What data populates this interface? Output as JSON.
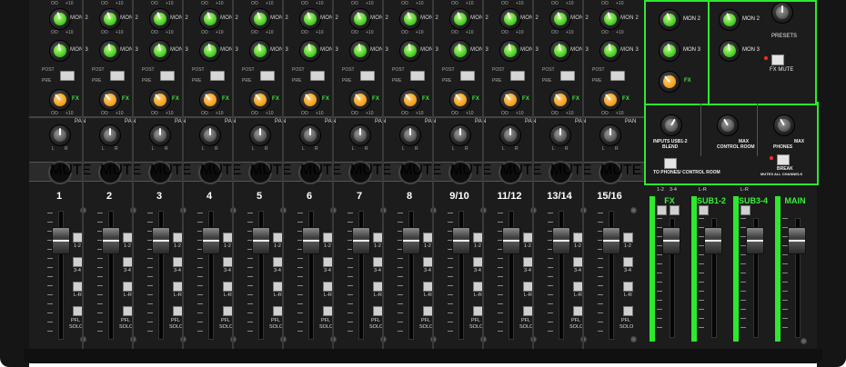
{
  "channels": [
    {
      "id": "1",
      "number": "1"
    },
    {
      "id": "2",
      "number": "2"
    },
    {
      "id": "3",
      "number": "3"
    },
    {
      "id": "4",
      "number": "4"
    },
    {
      "id": "5",
      "number": "5"
    },
    {
      "id": "6",
      "number": "6"
    },
    {
      "id": "7",
      "number": "7"
    },
    {
      "id": "8",
      "number": "8"
    },
    {
      "id": "9-10",
      "number": "9/10"
    },
    {
      "id": "11-12",
      "number": "11/12"
    },
    {
      "id": "13-14",
      "number": "13/14"
    },
    {
      "id": "15-16",
      "number": "15/16"
    }
  ],
  "strip_labels": {
    "mon2": "MON 2",
    "mon3": "MON 3",
    "fx": "FX",
    "pan": "PAN",
    "post": "POST",
    "pre": "PRE",
    "mute": "MUTE",
    "min": "OO",
    "max": "+10",
    "pan_l": "L",
    "pan_r": "R",
    "assign_12": "1-2",
    "assign_34": "3-4",
    "assign_lr": "L-R",
    "pfl": "PFL",
    "solo": "SOLO"
  },
  "master": {
    "presets": "PRESETS",
    "fx_mute": "FX MUTE",
    "inputs_usb_blend": "INPUTS USB1-2",
    "blend": "BLEND",
    "control_room": "CONTROL ROOM",
    "phones": "PHONES",
    "max": "MAX",
    "to_phones": "TO PHONES/ CONTROL ROOM",
    "break": "BREAK",
    "break_sub": "MUTES ALL CHANNELS",
    "mon2": "MON 2",
    "mon3": "MON 3",
    "fx": "FX",
    "buses": [
      {
        "id": "fx",
        "title": "FX",
        "assigns": [
          "1-2",
          "3-4"
        ]
      },
      {
        "id": "sub12",
        "title": "SUB1-2",
        "assigns": [
          "L-R"
        ]
      },
      {
        "id": "sub34",
        "title": "SUB3-4",
        "assigns": [
          "L-R"
        ]
      },
      {
        "id": "main",
        "title": "MAIN",
        "assigns": []
      }
    ]
  },
  "colors": {
    "accent_green": "#2ee82e",
    "mute_red": "#e02020",
    "knob_green": "#3cc41e",
    "knob_orange": "#f29b12"
  }
}
